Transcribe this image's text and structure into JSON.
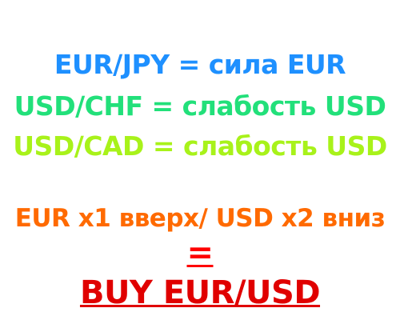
{
  "lines": [
    {
      "text": "EUR/JPY = сила EUR",
      "color": "#1e90ff"
    },
    {
      "text": "USD/CHF = слабость USD",
      "color": "#22e07a"
    },
    {
      "text": "USD/CAD = слабость USD",
      "color": "#a8f21a"
    },
    {
      "text": "EUR x1 вверх/ USD x2 вниз",
      "color": "#ff6a00"
    },
    {
      "text": "=",
      "color": "#ff0000"
    },
    {
      "text": "BUY EUR/USD",
      "color": "#e00000"
    }
  ]
}
